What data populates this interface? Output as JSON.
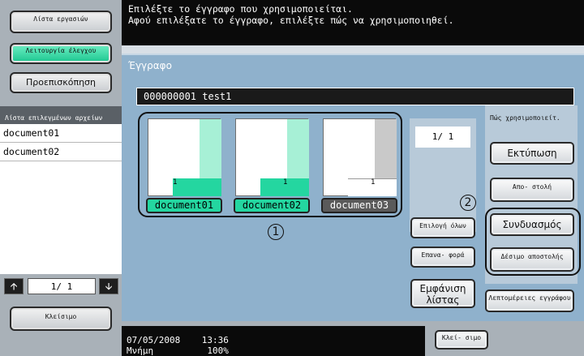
{
  "sidebar": {
    "job_list_label": "Λίστα εργασιών",
    "check_job_label": "Λειτουργία έλεγχου",
    "preview_label": "Προεπισκόπηση",
    "selected_files_header": "Λίστα επιλεγμένων αρχείων",
    "files": [
      "document01",
      "document02"
    ],
    "pager_text": "1/ 1",
    "close_label": "Κλείσιμο"
  },
  "message": {
    "line1": "Επιλέξτε το έγγραφο που χρησιμοποιείται.",
    "line2": "Αφού επιλέξατε το έγγραφο, επιλέξτε πώς να χρησιμοποιηθεί."
  },
  "panel": {
    "title": "Έγγραφο",
    "box_name": "000000001  test1",
    "page_indicator": "1/  1",
    "documents": [
      {
        "name": "document01",
        "pages": "1"
      },
      {
        "name": "document02",
        "pages": "1"
      },
      {
        "name": "document03",
        "pages": "1"
      }
    ],
    "callout_1": "1",
    "callout_2": "2",
    "select_all_label": "Επιλογή όλων",
    "reset_label": "Επανα- φορά",
    "show_list_label": "Εμφάνιση λίστας",
    "usage_header": "Πώς χρησιμοποιείτ.",
    "print_label": "Εκτύπωση",
    "send_label": "Απο- στολή",
    "combine_label": "Συνδυασμός",
    "bind_tx_label": "Δέσιμο αποστολής",
    "doc_details_label": "Λεπτομέρειες εγγράφου"
  },
  "status": {
    "date": "07/05/2008",
    "time": "13:36",
    "memory_label": "Μνήμη",
    "memory_value": "100%"
  },
  "footer": {
    "close_label": "Κλεί- σιμο"
  },
  "colors": {
    "accent": "#24d6a0",
    "panel": "#8fb1cc",
    "sidebar": "#a9b1b8"
  }
}
